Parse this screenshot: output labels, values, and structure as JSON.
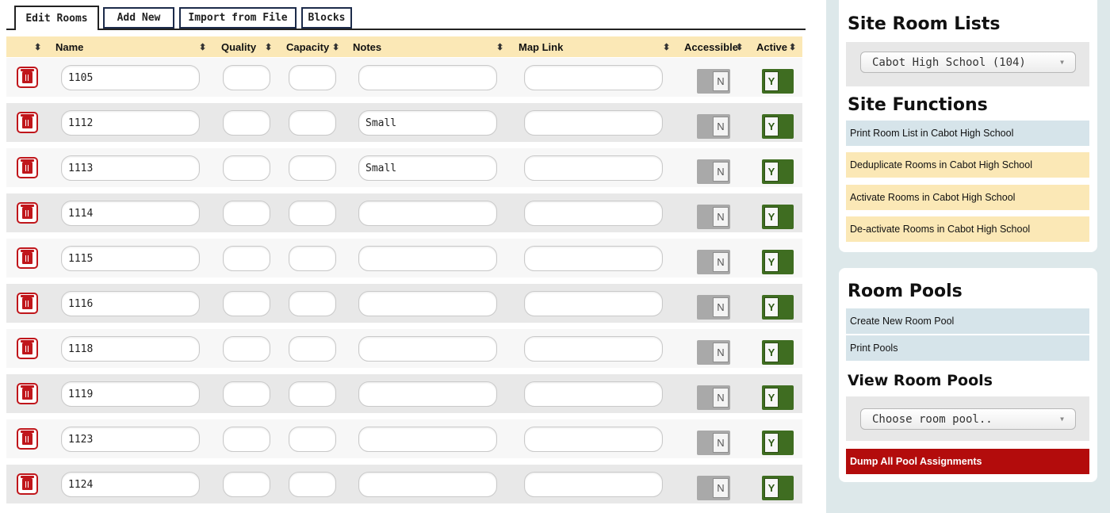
{
  "tabs": [
    "Edit Rooms",
    "Add New",
    "Import from File",
    "Blocks"
  ],
  "columns": {
    "name": "Name",
    "quality": "Quality",
    "capacity": "Capacity",
    "notes": "Notes",
    "map_link": "Map Link",
    "accessible": "Accessible",
    "active": "Active"
  },
  "sort_icon": "⬍",
  "toggle_no": "N",
  "toggle_yes": "Y",
  "rows": [
    {
      "name": "1105",
      "quality": "",
      "capacity": "",
      "notes": "",
      "map_link": "",
      "accessible": "N",
      "active": "Y"
    },
    {
      "name": "1112",
      "quality": "",
      "capacity": "",
      "notes": "Small",
      "map_link": "",
      "accessible": "N",
      "active": "Y"
    },
    {
      "name": "1113",
      "quality": "",
      "capacity": "",
      "notes": "Small",
      "map_link": "",
      "accessible": "N",
      "active": "Y"
    },
    {
      "name": "1114",
      "quality": "",
      "capacity": "",
      "notes": "",
      "map_link": "",
      "accessible": "N",
      "active": "Y"
    },
    {
      "name": "1115",
      "quality": "",
      "capacity": "",
      "notes": "",
      "map_link": "",
      "accessible": "N",
      "active": "Y"
    },
    {
      "name": "1116",
      "quality": "",
      "capacity": "",
      "notes": "",
      "map_link": "",
      "accessible": "N",
      "active": "Y"
    },
    {
      "name": "1118",
      "quality": "",
      "capacity": "",
      "notes": "",
      "map_link": "",
      "accessible": "N",
      "active": "Y"
    },
    {
      "name": "1119",
      "quality": "",
      "capacity": "",
      "notes": "",
      "map_link": "",
      "accessible": "N",
      "active": "Y"
    },
    {
      "name": "1123",
      "quality": "",
      "capacity": "",
      "notes": "",
      "map_link": "",
      "accessible": "N",
      "active": "Y"
    },
    {
      "name": "1124",
      "quality": "",
      "capacity": "",
      "notes": "",
      "map_link": "",
      "accessible": "N",
      "active": "Y"
    }
  ],
  "sidebar": {
    "site_room_lists_title": "Site Room Lists",
    "site_select_value": "Cabot High School (104)",
    "site_functions_title": "Site Functions",
    "site_functions": [
      "Print Room List in Cabot High School",
      "Deduplicate Rooms in Cabot High School",
      "Activate Rooms in Cabot High School",
      "De-activate Rooms in Cabot High School"
    ],
    "room_pools_title": "Room Pools",
    "create_pool": "Create New Room Pool",
    "print_pools": "Print Pools",
    "view_pools_title": "View Room Pools",
    "pool_select_value": "Choose room pool..",
    "dump_assignments": "Dump All Pool Assignments",
    "select_caret": "▼"
  },
  "colors": {
    "header_bg": "#fbe8b6",
    "delete_red": "#c0161b",
    "active_green": "#3f6d21",
    "sidebar_bg": "#dde8ea",
    "fn_blue": "#d6e4ea",
    "fn_yellow": "#fbe8b6",
    "dump_red": "#b30c0c"
  }
}
